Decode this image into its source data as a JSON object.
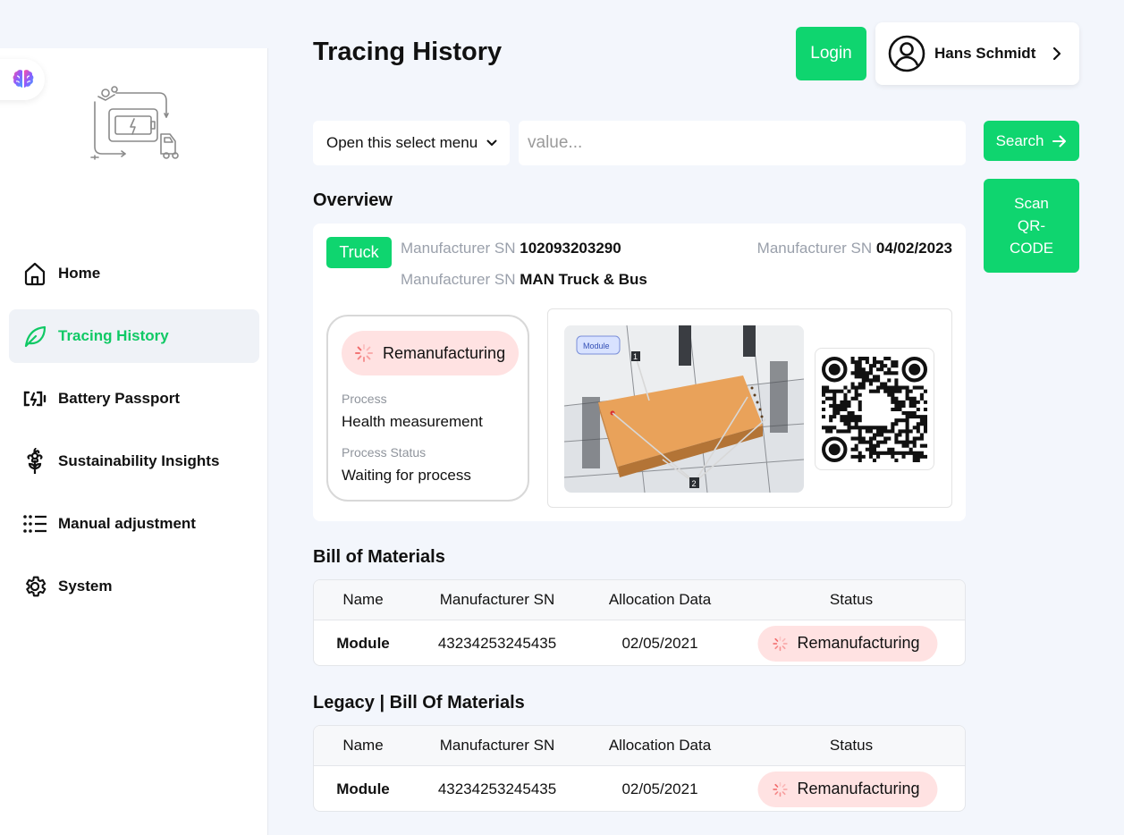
{
  "page": {
    "title": "Tracing History"
  },
  "header": {
    "login_label": "Login",
    "user_name": "Hans Schmidt"
  },
  "sidebar": {
    "items": [
      {
        "label": "Home",
        "icon": "home-icon",
        "active": false
      },
      {
        "label": "Tracing History",
        "icon": "leaf-icon",
        "active": true
      },
      {
        "label": "Battery Passport",
        "icon": "battery-icon",
        "active": false
      },
      {
        "label": "Sustainability Insights",
        "icon": "flower-icon",
        "active": false
      },
      {
        "label": "Manual adjustment",
        "icon": "list-icon",
        "active": false
      },
      {
        "label": "System",
        "icon": "gear-icon",
        "active": false
      }
    ]
  },
  "search": {
    "select_label": "Open this select menu",
    "placeholder": "value...",
    "search_label": "Search",
    "scan_label": "Scan QR-CODE"
  },
  "overview": {
    "title": "Overview",
    "badge": "Truck",
    "fields": [
      {
        "label": "Manufacturer SN",
        "value": "102093203290"
      },
      {
        "label": "Manufacturer SN",
        "value": "04/02/2023"
      },
      {
        "label": "Manufacturer SN",
        "value": "MAN Truck & Bus"
      }
    ],
    "status": "Remanufacturing",
    "process_label": "Process",
    "process_value": "Health measurement",
    "process_status_label": "Process Status",
    "process_status_value": "Waiting for process",
    "image": {
      "tag": "Module",
      "callout_1": "1",
      "callout_2": "2"
    }
  },
  "bom": {
    "title": "Bill of Materials",
    "headers": [
      "Name",
      "Manufacturer SN",
      "Allocation Data",
      "Status"
    ],
    "rows": [
      {
        "name": "Module",
        "sn": "43234253245435",
        "date": "02/05/2021",
        "status": "Remanufacturing"
      }
    ]
  },
  "legacy_bom": {
    "title": "Legacy | Bill Of Materials",
    "headers": [
      "Name",
      "Manufacturer SN",
      "Allocation Data",
      "Status"
    ],
    "rows": [
      {
        "name": "Module",
        "sn": "43234253245435",
        "date": "02/05/2021",
        "status": "Remanufacturing"
      }
    ]
  },
  "colors": {
    "accent": "#0fd56f",
    "status_bg": "#ffe2e2",
    "page_bg": "#f3f6fc"
  }
}
